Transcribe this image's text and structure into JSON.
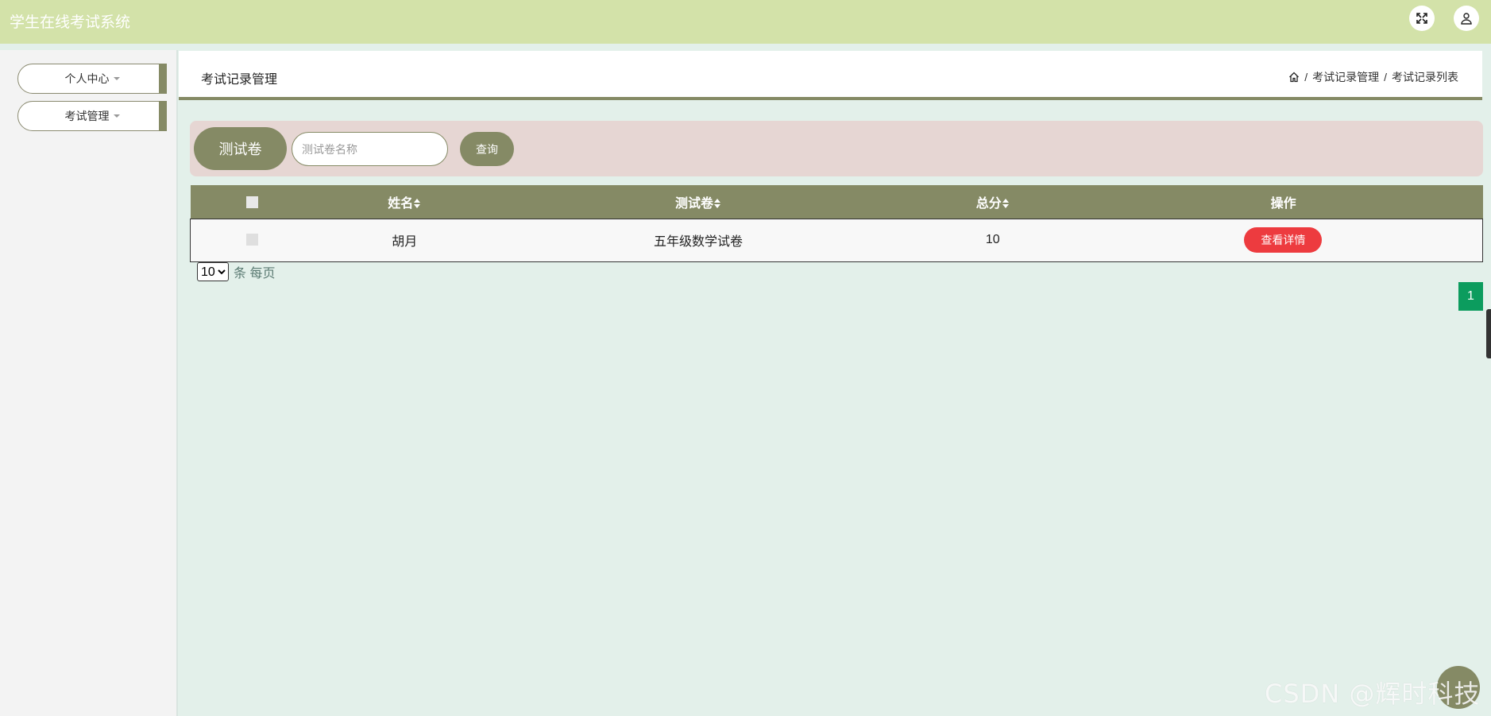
{
  "app": {
    "title": "学生在线考试系统"
  },
  "header_icons": {
    "fullscreen": "fullscreen-icon",
    "user": "user-icon"
  },
  "sidebar": {
    "items": [
      {
        "label": "个人中心"
      },
      {
        "label": "考试管理"
      }
    ]
  },
  "page": {
    "title": "考试记录管理",
    "breadcrumb": {
      "home_icon": "home-icon",
      "sep": "/",
      "crumbs": [
        "考试记录管理",
        "考试记录列表"
      ]
    }
  },
  "search": {
    "label": "测试卷",
    "placeholder": "测试卷名称",
    "button": "查询"
  },
  "table": {
    "columns": [
      "姓名",
      "测试卷",
      "总分",
      "操作"
    ],
    "rows": [
      {
        "name": "胡月",
        "paper": "五年级数学试卷",
        "score": "10",
        "action": "查看详情"
      }
    ]
  },
  "pagination": {
    "page_size": "10",
    "page_size_options": [
      "10"
    ],
    "per_page_text": "条 每页",
    "current_page": "1"
  },
  "watermark": "CSDN @辉时科技",
  "colors": {
    "topbar": "#d3e2a9",
    "accent": "#858a65",
    "danger": "#ed3b3f",
    "page_active": "#0c9c5e",
    "background": "#e3f0ea"
  }
}
